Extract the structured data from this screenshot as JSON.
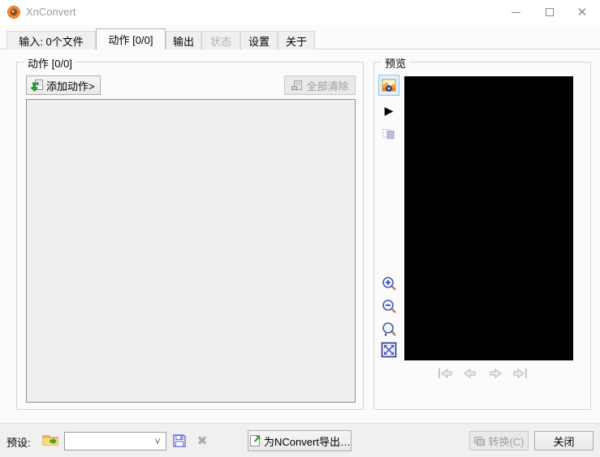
{
  "window": {
    "title": "XnConvert"
  },
  "tabs": [
    {
      "label": "输入: 0个文件",
      "state": "normal"
    },
    {
      "label": "动作 [0/0]",
      "state": "active"
    },
    {
      "label": "输出",
      "state": "normal"
    },
    {
      "label": "状态",
      "state": "disabled"
    },
    {
      "label": "设置",
      "state": "normal"
    },
    {
      "label": "关于",
      "state": "normal"
    }
  ],
  "actions_panel": {
    "title": "动作 [0/0]",
    "add_button": "添加动作>",
    "clear_button": "全部清除"
  },
  "preview_panel": {
    "title": "预览"
  },
  "bottom_bar": {
    "presets_label": "预设:",
    "preset_value": "",
    "export_button": "为NConvert导出…",
    "convert_button": "转换(C)",
    "close_button": "关闭"
  },
  "icons": {
    "delete_x": "✖",
    "play": "▶",
    "chevron": "˅"
  },
  "colors": {
    "preview_bg": "#000000",
    "highlight_border": "#93c2e8",
    "highlight_bg": "#e2f0fb",
    "disabled_text": "#9f9f9f"
  }
}
